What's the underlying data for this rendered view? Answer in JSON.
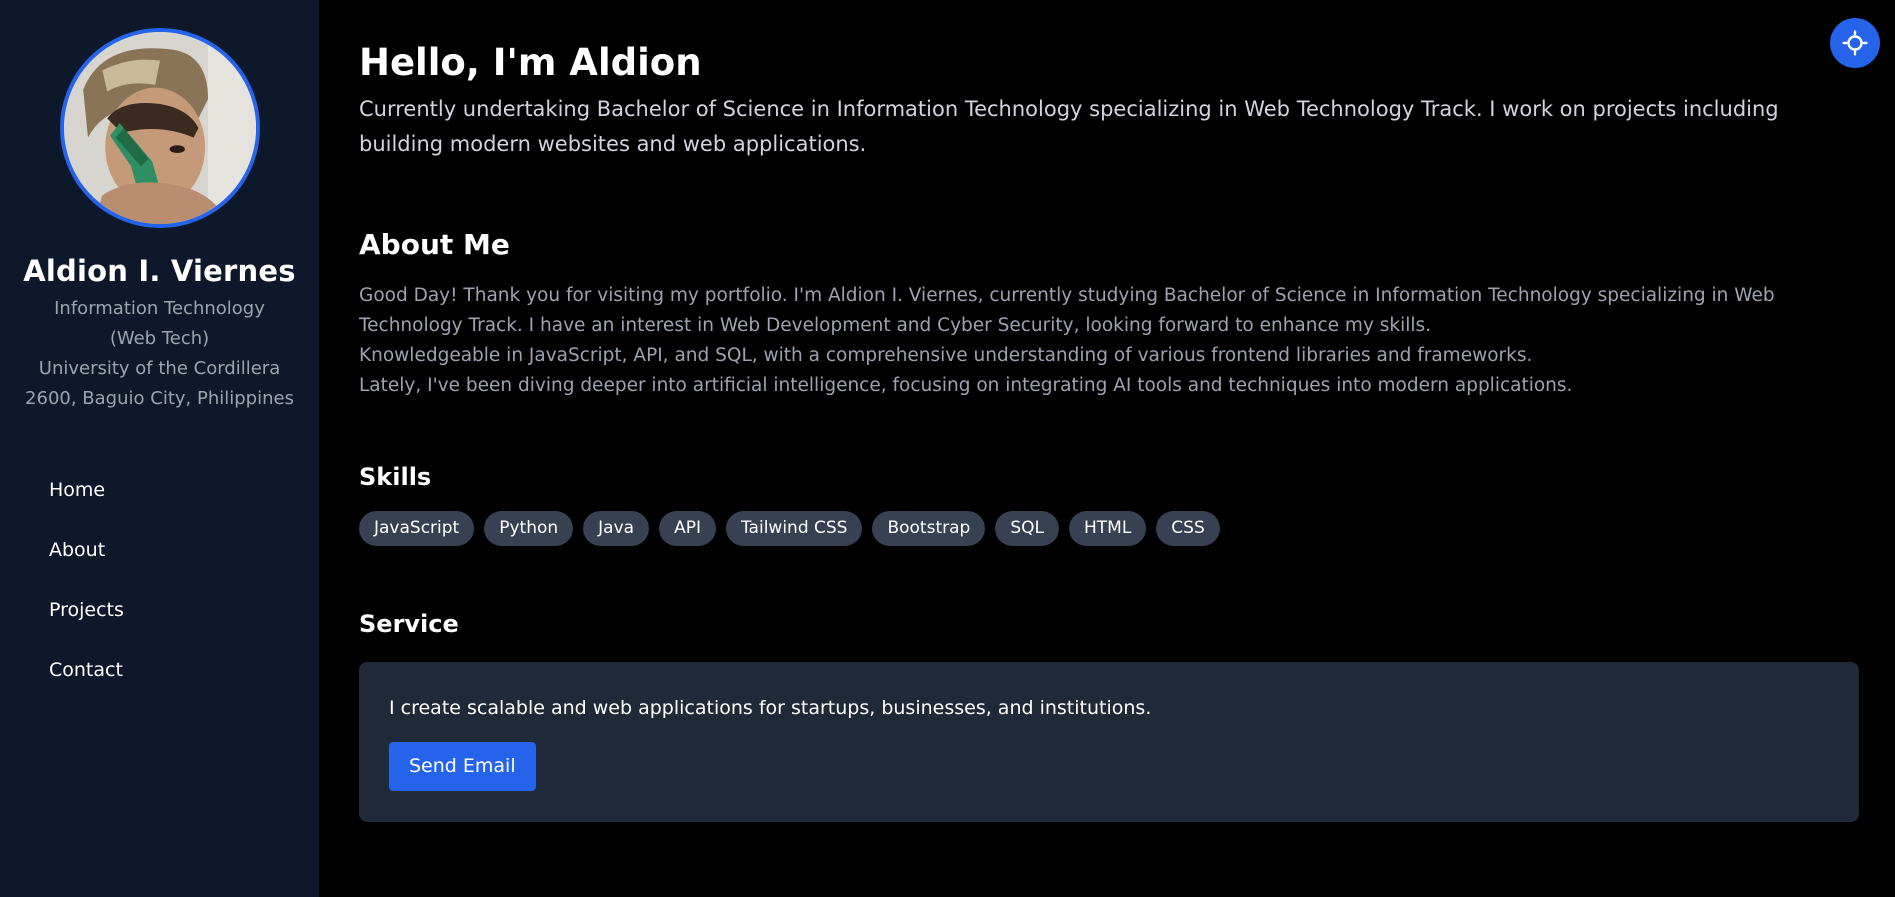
{
  "profile": {
    "name": "Aldion I. Viernes",
    "lines": [
      "Information Technology",
      "(Web Tech)",
      "University of the Cordillera",
      "2600, Baguio City, Philippines"
    ]
  },
  "nav": {
    "items": [
      {
        "label": "Home"
      },
      {
        "label": "About"
      },
      {
        "label": "Projects"
      },
      {
        "label": "Contact"
      }
    ]
  },
  "theme_toggle": {
    "icon": "sun-icon"
  },
  "hero": {
    "title": "Hello, I'm Aldion",
    "description": "Currently undertaking Bachelor of Science in Information Technology specializing in Web Technology Track. I work on projects including building modern websites and web applications."
  },
  "about": {
    "title": "About Me",
    "paragraphs": [
      "Good Day! Thank you for visiting my portfolio. I'm Aldion I. Viernes, currently studying Bachelor of Science in Information Technology specializing in Web Technology Track. I have an interest in Web Development and Cyber Security, looking forward to enhance my skills.",
      "Knowledgeable in JavaScript, API, and SQL, with a comprehensive understanding of various frontend libraries and frameworks.",
      "Lately, I've been diving deeper into artificial intelligence, focusing on integrating AI tools and techniques into modern applications."
    ]
  },
  "skills": {
    "title": "Skills",
    "items": [
      "JavaScript",
      "Python",
      "Java",
      "API",
      "Tailwind CSS",
      "Bootstrap",
      "SQL",
      "HTML",
      "CSS"
    ]
  },
  "service": {
    "title": "Service",
    "text": "I create scalable and web applications for startups, businesses, and institutions.",
    "button_label": "Send Email"
  },
  "colors": {
    "accent": "#2563eb",
    "sidebar_bg": "#0f172a",
    "page_bg": "#000000",
    "card_bg": "#1f2937",
    "chip_bg": "#374151"
  }
}
